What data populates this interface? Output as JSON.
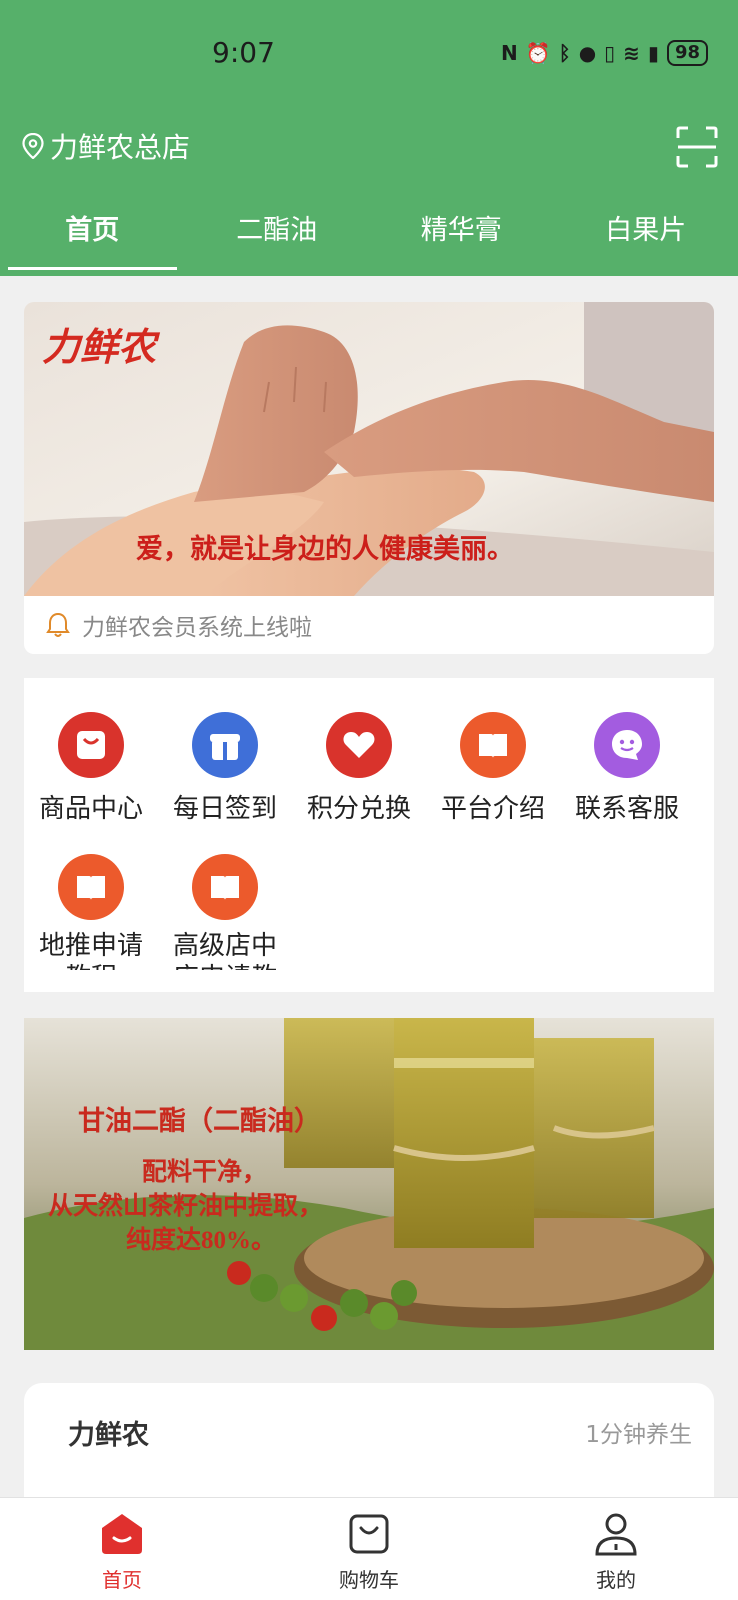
{
  "status_bar": {
    "time": "9:07",
    "battery": "98",
    "icons": [
      "nfc-icon",
      "alarm-icon",
      "bluetooth-icon",
      "location-icon",
      "vibrate-icon",
      "wifi-icon",
      "signal-icon"
    ]
  },
  "header": {
    "store_name": "力鲜农总店",
    "tabs": [
      {
        "label": "首页",
        "active": true
      },
      {
        "label": "二酯油",
        "active": false
      },
      {
        "label": "精华膏",
        "active": false
      },
      {
        "label": "白果片",
        "active": false
      }
    ]
  },
  "banner1": {
    "logo": "力鲜农",
    "slogan": "爱，就是让身边的人健康美丽。"
  },
  "notice": {
    "text": "力鲜农会员系统上线啦"
  },
  "menu": {
    "items": [
      {
        "label": "商品中心",
        "icon": "bag-icon",
        "color": "#d9332c"
      },
      {
        "label": "每日签到",
        "icon": "gift-icon",
        "color": "#3f6fd8"
      },
      {
        "label": "积分兑换",
        "icon": "heart-icon",
        "color": "#d9332c"
      },
      {
        "label": "平台介绍",
        "icon": "book-icon",
        "color": "#ec5a2c"
      },
      {
        "label": "联系客服",
        "icon": "chat-face-icon",
        "color": "#a35ce0"
      },
      {
        "label": "地推申请教程",
        "icon": "book-icon",
        "color": "#ec5a2c"
      },
      {
        "label": "高级店中店申请教",
        "icon": "book-icon",
        "color": "#ec5a2c"
      }
    ]
  },
  "banner2": {
    "title": "甘油二酯（二酯油）",
    "line1": "配料干净，",
    "line2": "从天然山茶籽油中提取，",
    "line3": "纯度达80%。"
  },
  "brand_card": {
    "name": "力鲜农",
    "subtitle": "1分钟养生"
  },
  "bottom_nav": [
    {
      "label": "首页",
      "icon": "home-icon",
      "active": true
    },
    {
      "label": "购物车",
      "icon": "cart-icon",
      "active": false
    },
    {
      "label": "我的",
      "icon": "user-icon",
      "active": false
    }
  ],
  "colors": {
    "header_green": "#56b06a",
    "accent_red": "#e0302e"
  }
}
